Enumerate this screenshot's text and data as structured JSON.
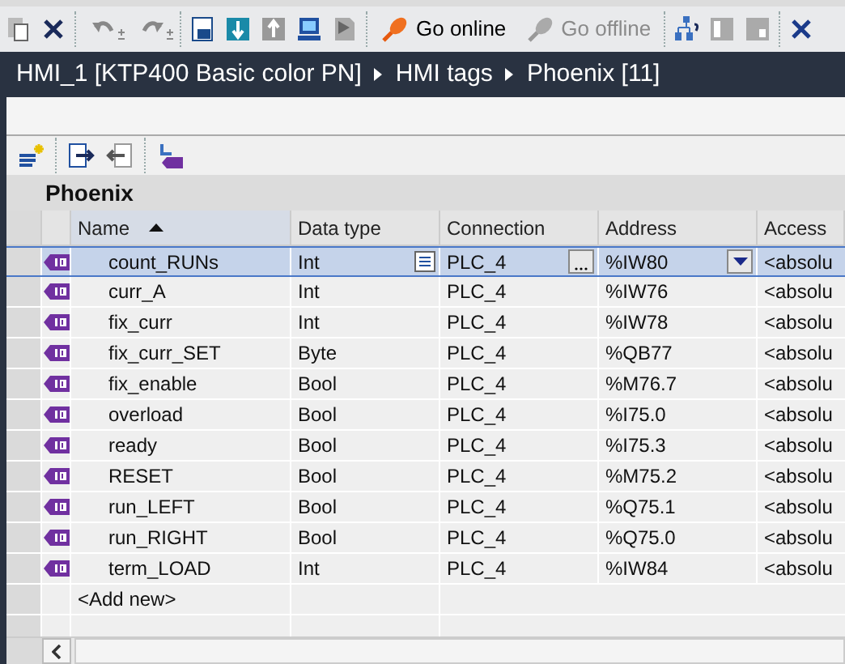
{
  "toolbar": {
    "go_online": {
      "label": "Go online",
      "disabled": false
    },
    "go_offline": {
      "label": "Go offline",
      "disabled": true
    }
  },
  "breadcrumb": [
    "HMI_1 [KTP400 Basic color PN]",
    "HMI tags",
    "Phoenix [11]"
  ],
  "table": {
    "title": "Phoenix",
    "columns": [
      {
        "label": "Name",
        "sorted": true
      },
      {
        "label": "Data type",
        "sorted": false
      },
      {
        "label": "Connection",
        "sorted": false
      },
      {
        "label": "Address",
        "sorted": false
      },
      {
        "label": "Access",
        "sorted": false
      }
    ],
    "rows": [
      {
        "name": "count_RUNs",
        "data_type": "Int",
        "connection": "PLC_4",
        "address": "%IW80",
        "access": "<absolu",
        "selected": true
      },
      {
        "name": "curr_A",
        "data_type": "Int",
        "connection": "PLC_4",
        "address": "%IW76",
        "access": "<absolu",
        "selected": false
      },
      {
        "name": "fix_curr",
        "data_type": "Int",
        "connection": "PLC_4",
        "address": "%IW78",
        "access": "<absolu",
        "selected": false
      },
      {
        "name": "fix_curr_SET",
        "data_type": "Byte",
        "connection": "PLC_4",
        "address": "%QB77",
        "access": "<absolu",
        "selected": false
      },
      {
        "name": "fix_enable",
        "data_type": "Bool",
        "connection": "PLC_4",
        "address": "%M76.7",
        "access": "<absolu",
        "selected": false
      },
      {
        "name": "overload",
        "data_type": "Bool",
        "connection": "PLC_4",
        "address": "%I75.0",
        "access": "<absolu",
        "selected": false
      },
      {
        "name": "ready",
        "data_type": "Bool",
        "connection": "PLC_4",
        "address": "%I75.3",
        "access": "<absolu",
        "selected": false
      },
      {
        "name": "RESET",
        "data_type": "Bool",
        "connection": "PLC_4",
        "address": "%M75.2",
        "access": "<absolu",
        "selected": false
      },
      {
        "name": "run_LEFT",
        "data_type": "Bool",
        "connection": "PLC_4",
        "address": "%Q75.1",
        "access": "<absolu",
        "selected": false
      },
      {
        "name": "run_RIGHT",
        "data_type": "Bool",
        "connection": "PLC_4",
        "address": "%Q75.0",
        "access": "<absolu",
        "selected": false
      },
      {
        "name": "term_LOAD",
        "data_type": "Int",
        "connection": "PLC_4",
        "address": "%IW84",
        "access": "<absolu",
        "selected": false
      }
    ],
    "add_new": "<Add new>"
  }
}
